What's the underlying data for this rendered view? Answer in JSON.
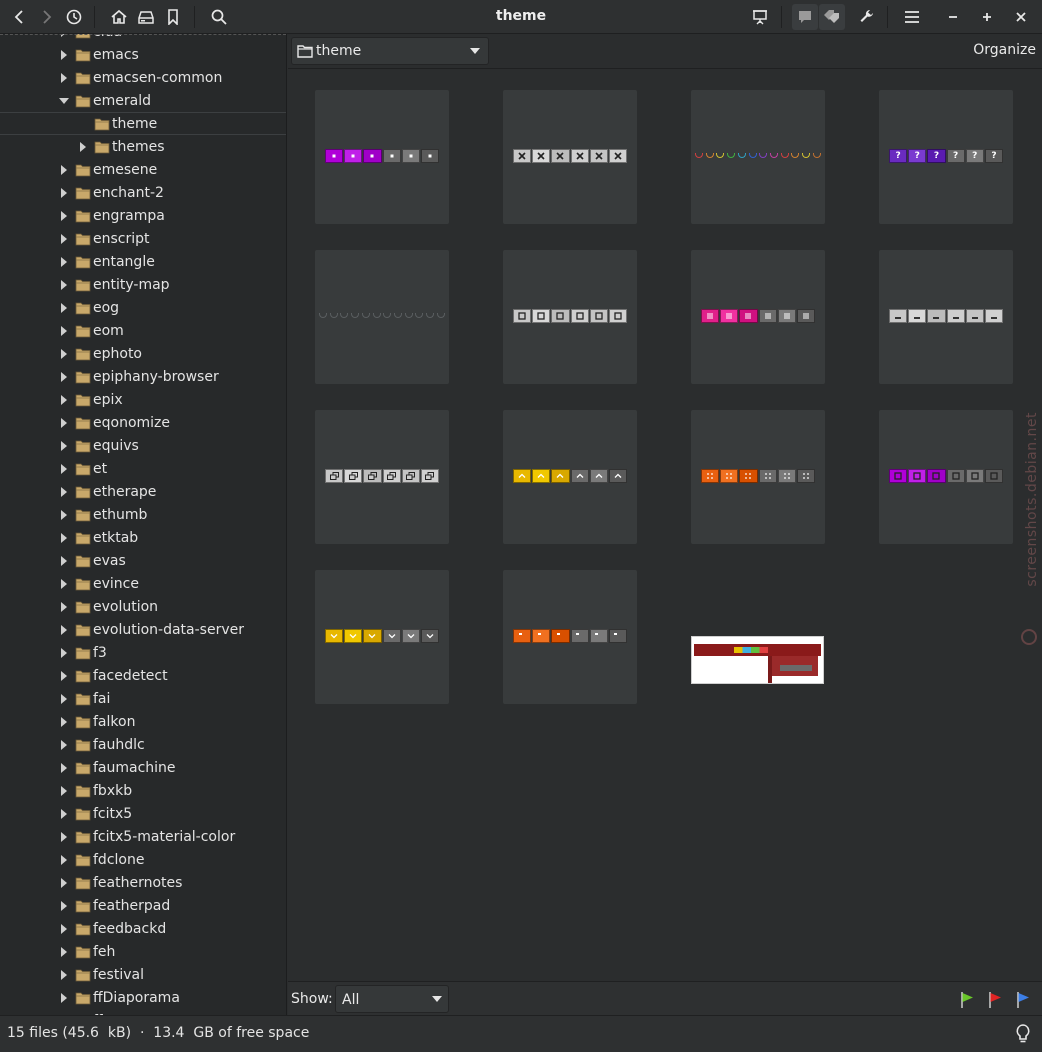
{
  "window": {
    "title": "theme"
  },
  "sidebar": {
    "items": [
      {
        "label": "cida",
        "depth": 1,
        "expanded": false
      },
      {
        "label": "emacs",
        "depth": 1,
        "expanded": false
      },
      {
        "label": "emacsen-common",
        "depth": 1,
        "expanded": false
      },
      {
        "label": "emerald",
        "depth": 1,
        "expanded": true
      },
      {
        "label": "theme",
        "depth": 2,
        "expanded": null,
        "selected": true
      },
      {
        "label": "themes",
        "depth": 2,
        "expanded": false
      },
      {
        "label": "emesene",
        "depth": 1,
        "expanded": false
      },
      {
        "label": "enchant-2",
        "depth": 1,
        "expanded": false
      },
      {
        "label": "engrampa",
        "depth": 1,
        "expanded": false
      },
      {
        "label": "enscript",
        "depth": 1,
        "expanded": false
      },
      {
        "label": "entangle",
        "depth": 1,
        "expanded": false
      },
      {
        "label": "entity-map",
        "depth": 1,
        "expanded": false
      },
      {
        "label": "eog",
        "depth": 1,
        "expanded": false
      },
      {
        "label": "eom",
        "depth": 1,
        "expanded": false
      },
      {
        "label": "ephoto",
        "depth": 1,
        "expanded": false
      },
      {
        "label": "epiphany-browser",
        "depth": 1,
        "expanded": false
      },
      {
        "label": "epix",
        "depth": 1,
        "expanded": false
      },
      {
        "label": "eqonomize",
        "depth": 1,
        "expanded": false
      },
      {
        "label": "equivs",
        "depth": 1,
        "expanded": false
      },
      {
        "label": "et",
        "depth": 1,
        "expanded": false
      },
      {
        "label": "etherape",
        "depth": 1,
        "expanded": false
      },
      {
        "label": "ethumb",
        "depth": 1,
        "expanded": false
      },
      {
        "label": "etktab",
        "depth": 1,
        "expanded": false
      },
      {
        "label": "evas",
        "depth": 1,
        "expanded": false
      },
      {
        "label": "evince",
        "depth": 1,
        "expanded": false
      },
      {
        "label": "evolution",
        "depth": 1,
        "expanded": false
      },
      {
        "label": "evolution-data-server",
        "depth": 1,
        "expanded": false
      },
      {
        "label": "f3",
        "depth": 1,
        "expanded": false
      },
      {
        "label": "facedetect",
        "depth": 1,
        "expanded": false
      },
      {
        "label": "fai",
        "depth": 1,
        "expanded": false
      },
      {
        "label": "falkon",
        "depth": 1,
        "expanded": false
      },
      {
        "label": "fauhdlc",
        "depth": 1,
        "expanded": false
      },
      {
        "label": "faumachine",
        "depth": 1,
        "expanded": false
      },
      {
        "label": "fbxkb",
        "depth": 1,
        "expanded": false
      },
      {
        "label": "fcitx5",
        "depth": 1,
        "expanded": false
      },
      {
        "label": "fcitx5-material-color",
        "depth": 1,
        "expanded": false
      },
      {
        "label": "fdclone",
        "depth": 1,
        "expanded": false
      },
      {
        "label": "feathernotes",
        "depth": 1,
        "expanded": false
      },
      {
        "label": "featherpad",
        "depth": 1,
        "expanded": false
      },
      {
        "label": "feedbackd",
        "depth": 1,
        "expanded": false
      },
      {
        "label": "feh",
        "depth": 1,
        "expanded": false
      },
      {
        "label": "festival",
        "depth": 1,
        "expanded": false
      },
      {
        "label": "ffDiaporama",
        "depth": 1,
        "expanded": false
      },
      {
        "label": "ff...",
        "depth": 1,
        "expanded": false
      }
    ]
  },
  "location": {
    "folder": "theme",
    "organize_label": "Organize"
  },
  "thumbnails": [
    {
      "kind": "strip",
      "glyph": "dot",
      "colors": [
        "#b000d8",
        "#c020e8",
        "#a000c8",
        "#6a6a6a",
        "#7a7a7a",
        "#5a5a5a"
      ]
    },
    {
      "kind": "strip",
      "glyph": "x",
      "colors": [
        "#c8c8c8",
        "#d8d8d8",
        "#bcbcbc",
        "#cfcfcf",
        "#c4c4c4",
        "#d0d0d0"
      ]
    },
    {
      "kind": "dots",
      "colors": [
        "#d04040",
        "#d08030",
        "#d0c030",
        "#40b040",
        "#30a0c0",
        "#3060d0",
        "#8040c0",
        "#c040a0",
        "#d04040",
        "#d08030",
        "#d0c030",
        "#c07030"
      ]
    },
    {
      "kind": "strip",
      "glyph": "?",
      "colors": [
        "#6a2bc0",
        "#7a3bd0",
        "#5a1bb0",
        "#6a6a6a",
        "#7a7a7a",
        "#5a5a5a"
      ]
    },
    {
      "kind": "dots",
      "colors": [
        "#5a5e60",
        "#5a5e60",
        "#5a5e60",
        "#5a5e60",
        "#5a5e60",
        "#5a5e60",
        "#5a5e60",
        "#5a5e60",
        "#5a5e60",
        "#5a5e60",
        "#5a5e60",
        "#5a5e60"
      ]
    },
    {
      "kind": "strip",
      "glyph": "sq",
      "colors": [
        "#c8c8c8",
        "#d8d8d8",
        "#bcbcbc",
        "#cfcfcf",
        "#c4c4c4",
        "#d0d0d0"
      ]
    },
    {
      "kind": "strip",
      "glyph": "menu",
      "colors": [
        "#e0208a",
        "#f030a0",
        "#d01080",
        "#6a6a6a",
        "#7a7a7a",
        "#5a5a5a"
      ]
    },
    {
      "kind": "strip",
      "glyph": "min",
      "colors": [
        "#c8c8c8",
        "#d8d8d8",
        "#bcbcbc",
        "#cfcfcf",
        "#c4c4c4",
        "#d0d0d0"
      ]
    },
    {
      "kind": "strip",
      "glyph": "restore",
      "colors": [
        "#c8c8c8",
        "#d8d8d8",
        "#bcbcbc",
        "#cfcfcf",
        "#c4c4c4",
        "#d0d0d0"
      ]
    },
    {
      "kind": "strip",
      "glyph": "up",
      "colors": [
        "#e8b800",
        "#f0c800",
        "#d8a800",
        "#6a6a6a",
        "#7a7a7a",
        "#5a5a5a"
      ]
    },
    {
      "kind": "strip",
      "glyph": "dice",
      "colors": [
        "#e86010",
        "#f07020",
        "#d85000",
        "#6a6a6a",
        "#7a7a7a",
        "#5a5a5a"
      ]
    },
    {
      "kind": "strip",
      "glyph": "sq",
      "colors": [
        "#b000d8",
        "#c020e8",
        "#a000c8",
        "#6a6a6a",
        "#7a7a7a",
        "#5a5a5a"
      ]
    },
    {
      "kind": "strip",
      "glyph": "down",
      "colors": [
        "#e8b800",
        "#f0c800",
        "#d8a800",
        "#6a6a6a",
        "#7a7a7a",
        "#5a5a5a"
      ]
    },
    {
      "kind": "strip",
      "glyph": "shade",
      "colors": [
        "#e86010",
        "#f07020",
        "#d85000",
        "#6a6a6a",
        "#7a7a7a",
        "#5a5a5a"
      ]
    },
    {
      "kind": "preview"
    }
  ],
  "show_bar": {
    "label": "Show:",
    "value": "All"
  },
  "flags": [
    {
      "name": "green-flag",
      "color": "#6ac62a"
    },
    {
      "name": "red-flag",
      "color": "#e02424"
    },
    {
      "name": "blue-flag",
      "color": "#3c7ee6"
    }
  ],
  "status": {
    "text": "15 files (45.6  kB)  ·  13.4  GB of free space"
  },
  "watermark": {
    "text": "screenshots.debian.net"
  },
  "colors": {
    "background": "#2b2d2e",
    "sidebar": "#27292a",
    "thumb_bg": "#383b3c",
    "folder": "#c8a86a"
  }
}
